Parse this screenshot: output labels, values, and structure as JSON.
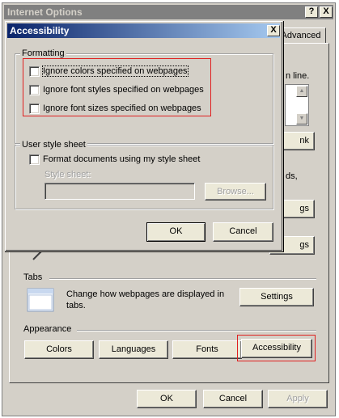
{
  "internet_options": {
    "title": "Internet Options",
    "help_glyph": "?",
    "close_glyph": "X",
    "tab_advanced": "Advanced",
    "partial_text_1": "n line.",
    "partial_btn_1": "nk",
    "partial_text_2": "ds,",
    "partial_btn_2": "gs",
    "partial_btn_3": "gs",
    "tabs_section": {
      "heading": "Tabs",
      "description": "Change how webpages are displayed in tabs.",
      "settings_label": "Settings"
    },
    "appearance_section": {
      "heading": "Appearance",
      "colors_label": "Colors",
      "languages_label": "Languages",
      "fonts_label": "Fonts",
      "accessibility_label": "Accessibility"
    },
    "ok_label": "OK",
    "cancel_label": "Cancel",
    "apply_label": "Apply"
  },
  "accessibility_dialog": {
    "title": "Accessibility",
    "close_glyph": "X",
    "formatting": {
      "heading": "Formatting",
      "options": [
        {
          "label": "Ignore colors specified on webpages",
          "checked": false
        },
        {
          "label": "Ignore font styles specified on webpages",
          "checked": false
        },
        {
          "label": "Ignore font sizes specified on webpages",
          "checked": false
        }
      ]
    },
    "user_style_sheet": {
      "heading": "User style sheet",
      "format_label": "Format documents using my style sheet",
      "style_sheet_label": "Style sheet:",
      "style_sheet_value": "",
      "browse_label": "Browse..."
    },
    "ok_label": "OK",
    "cancel_label": "Cancel"
  },
  "colors": {
    "dialog_face": "#d4d0c8",
    "title_active_start": "#0a246a",
    "title_active_end": "#a6caf0",
    "title_inactive": "#808080",
    "highlight_red": "#e02020"
  }
}
